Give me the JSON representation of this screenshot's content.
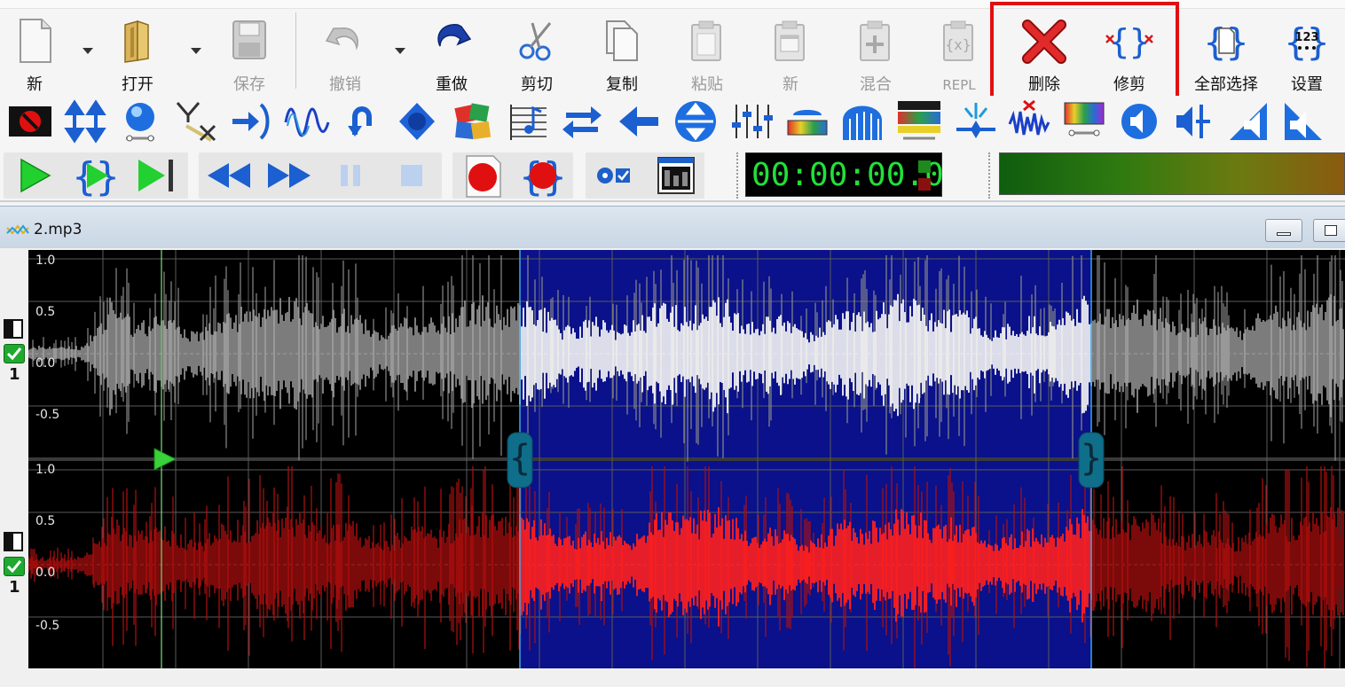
{
  "toolbar": {
    "new_label": "新",
    "open_label": "打开",
    "save_label": "保存",
    "undo_label": "撤销",
    "redo_label": "重做",
    "cut_label": "剪切",
    "copy_label": "复制",
    "paste_label": "粘贴",
    "paste_new_label": "新",
    "mix_label": "混合",
    "repl_label": "REPL",
    "delete_label": "删除",
    "trim_label": "修剪",
    "select_all_label": "全部选择",
    "settings_label": "设置"
  },
  "transport": {
    "time": "00:00:00.0"
  },
  "document": {
    "title": "2.mp3",
    "channel_1_label": "1",
    "channel_2_label": "1"
  },
  "axis": {
    "top_ticks": [
      "1.0",
      "0.5",
      "0.0",
      "-0.5"
    ],
    "bottom_ticks": [
      "1.0",
      "0.5",
      "0.0",
      "-0.5"
    ]
  },
  "selection": {
    "start_fraction": 0.373,
    "end_fraction": 0.807
  },
  "playhead": {
    "fraction": 0.101
  },
  "colors": {
    "accent_red": "#e01010",
    "selection_bg": "#0a118a",
    "left_wave": "#c8c8c8",
    "right_wave": "#d01010",
    "time_text": "#22e03a"
  }
}
